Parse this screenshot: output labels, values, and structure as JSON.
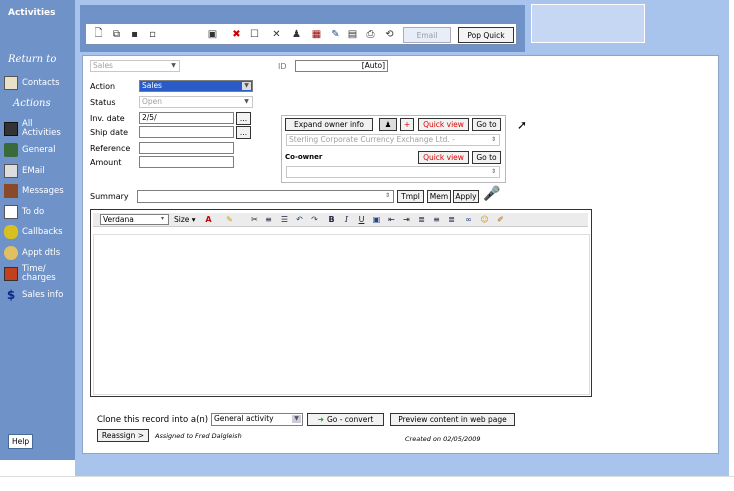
{
  "app": {
    "title": "Activities"
  },
  "sidebar": {
    "return_to": "Return to",
    "actions_header": "Actions",
    "items": [
      {
        "label": "Contacts",
        "icon": "contacts-icon"
      },
      {
        "label": "All Activities",
        "icon": "all-activities-icon"
      },
      {
        "label": "General",
        "icon": "general-icon"
      },
      {
        "label": "EMail",
        "icon": "email-icon"
      },
      {
        "label": "Messages",
        "icon": "messages-icon"
      },
      {
        "label": "To do",
        "icon": "todo-icon"
      },
      {
        "label": "Callbacks",
        "icon": "callbacks-icon"
      },
      {
        "label": "Appt dtls",
        "icon": "appointment-icon"
      },
      {
        "label": "Time/ charges",
        "icon": "time-charges-icon"
      },
      {
        "label": "Sales info",
        "icon": "sales-info-icon"
      }
    ],
    "help": "Help"
  },
  "toolbar": {
    "email_label": "Email",
    "popquick_label": "Pop Quick"
  },
  "form": {
    "type_select": "Sales",
    "id_label": "ID",
    "id_value": "[Auto]",
    "action_label": "Action",
    "action_value": "Sales",
    "status_label": "Status",
    "status_value": "Open",
    "inv_date_label": "Inv. date",
    "inv_date_value": "2/5/",
    "ship_date_label": "Ship date",
    "reference_label": "Reference",
    "amount_label": "Amount",
    "ellipsis": "..."
  },
  "owner": {
    "expand_label": "Expand owner info",
    "plus": "+",
    "quick_view": "Quick view",
    "go_to": "Go to",
    "owner_name": "Sterling Corporate Currency Exchange Ltd. -",
    "coowner_label": "Co-owner"
  },
  "summary": {
    "label": "Summary",
    "tmpl": "Tmpl",
    "mem": "Mem",
    "apply": "Apply"
  },
  "editor": {
    "font": "Verdana",
    "size": "Size"
  },
  "footer": {
    "clone_label": "Clone this record into a(n)",
    "clone_value": "General activity",
    "go_convert": "Go - convert",
    "preview": "Preview content in web page",
    "reassign": "Reassign >",
    "assigned_to": "Assigned to Fred Dalgleish",
    "created_on": "Created on 02/05/2009"
  }
}
